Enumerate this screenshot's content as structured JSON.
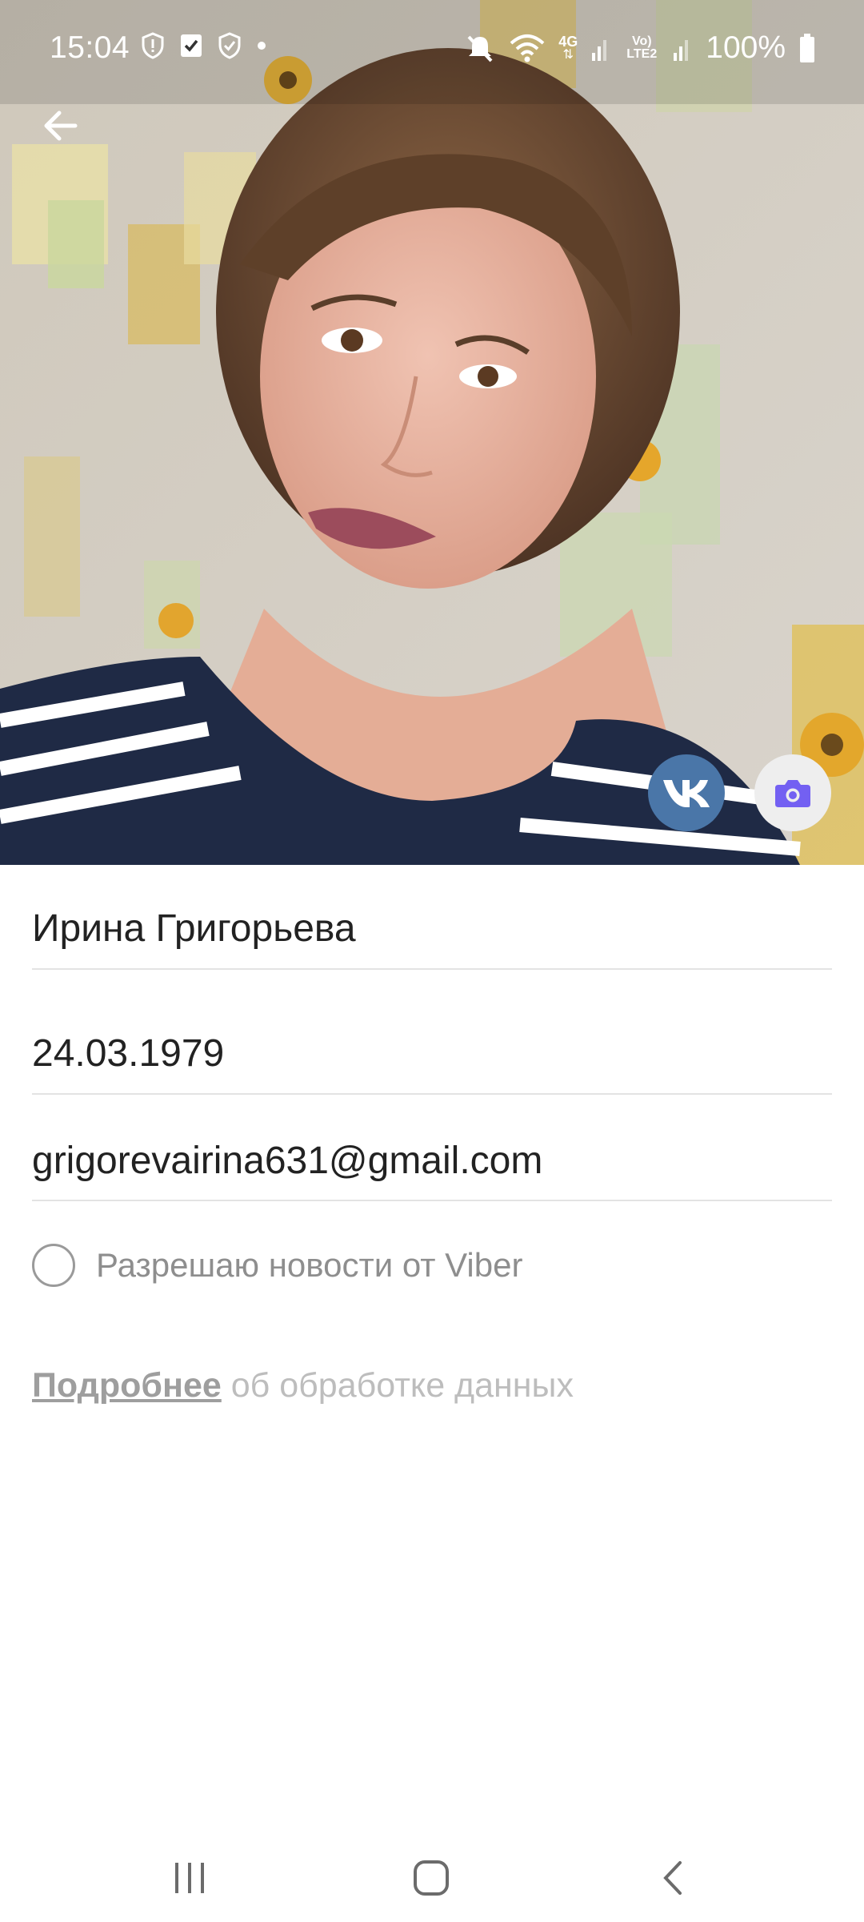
{
  "status_bar": {
    "time": "15:04",
    "network_4g": "4G",
    "volte": "Vo) LTE2",
    "battery": "100%",
    "icons": [
      "alert-shield-icon",
      "checkbox-notification-icon",
      "security-shield-icon",
      "notification-dot-icon",
      "mute-icon",
      "wifi-icon",
      "signal-icon",
      "battery-icon"
    ]
  },
  "header": {
    "back_icon": "arrow-left-icon",
    "vk_icon": "vk-logo-icon",
    "camera_icon": "camera-icon"
  },
  "profile": {
    "name": "Ирина Григорьева",
    "birthday": "24.03.1979",
    "email": "grigorevairina631@gmail.com"
  },
  "news_consent": {
    "label": "Разрешаю новости от Viber",
    "checked": false
  },
  "privacy": {
    "link_text": "Подробнее",
    "rest_text": " об обработке данных"
  },
  "colors": {
    "vk_blue": "#4a76a8",
    "viber_purple": "#7360f2"
  }
}
